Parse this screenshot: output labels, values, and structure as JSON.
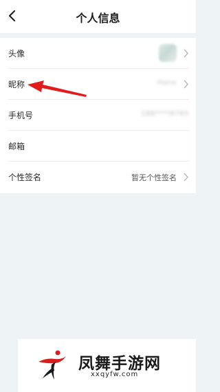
{
  "header": {
    "title": "个人信息"
  },
  "rows": [
    {
      "label": "头像"
    },
    {
      "label": "昵称",
      "value": "Hane"
    },
    {
      "label": "手机号",
      "value": "188****8765"
    },
    {
      "label": "邮箱"
    },
    {
      "label": "个性签名",
      "value": "暂无个性签名"
    }
  ],
  "watermark": {
    "name": "凤舞手游网",
    "url": "xxqyfw.com"
  },
  "colors": {
    "background": "#eef4f6",
    "arrow": "#e21b1b",
    "logo_accent": "#d81e1e"
  }
}
